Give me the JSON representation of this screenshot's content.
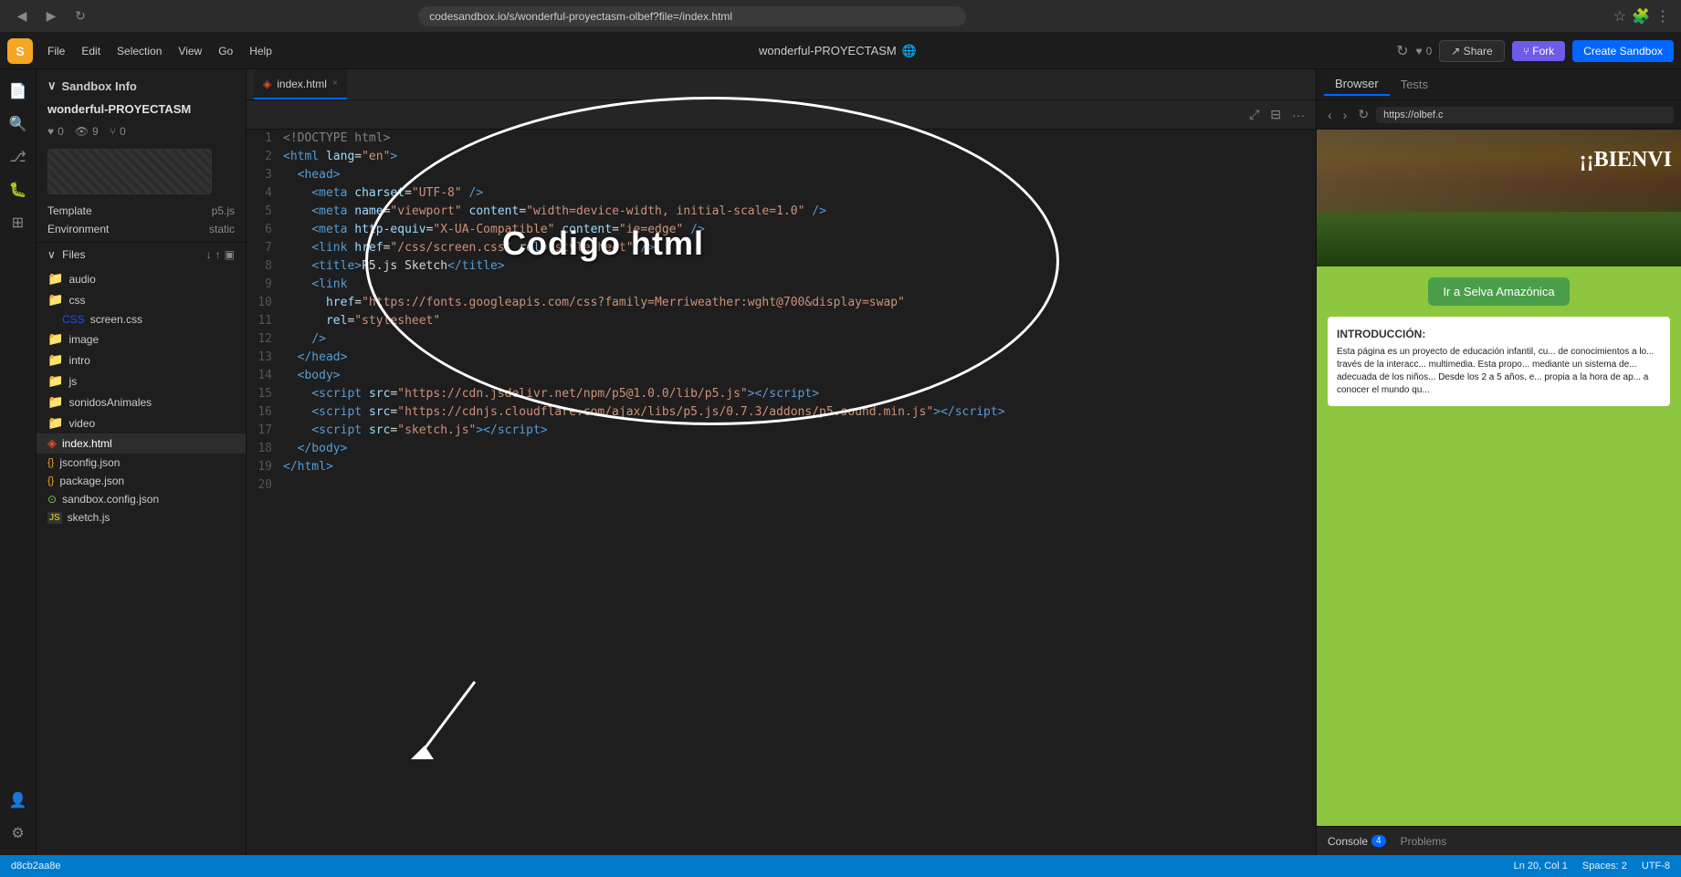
{
  "browser": {
    "url": "codesandbox.io/s/wonderful-proyectasm-olbef?file=/index.html",
    "back_icon": "◀",
    "forward_icon": "▶",
    "refresh_icon": "↻",
    "home_icon": "⌂"
  },
  "header": {
    "logo": "S",
    "menu": [
      "File",
      "Edit",
      "Selection",
      "View",
      "Go",
      "Help"
    ],
    "project_title": "wonderful-PROYECTASM",
    "globe_icon": "🌐",
    "heart_icon": "♥",
    "heart_count": "0",
    "eye_icon": "👁",
    "eye_count": "9",
    "fork_icon": "⑂",
    "fork_count": "0",
    "share_label": "↗ Share",
    "fork_label": "⑂ Fork",
    "create_sandbox_label": "Create Sandbox",
    "refresh_icon": "↻"
  },
  "sidebar": {
    "section_title": "Sandbox Info",
    "project_name": "wonderful-PROYECTASM",
    "stats": {
      "heart": "♥",
      "heart_count": "0",
      "eye": "👁",
      "eye_count": "9",
      "fork": "⑂",
      "fork_count": "0"
    },
    "labels": {
      "template": "Template",
      "environment": "Environment"
    },
    "template_value": "p5.js",
    "environment_value": "static",
    "files_section": "Files",
    "folders": [
      "audio",
      "css",
      "image",
      "intro",
      "js",
      "sonidosAnimales",
      "video"
    ],
    "files": [
      {
        "name": "screen.css",
        "type": "css"
      },
      {
        "name": "index.html",
        "type": "html",
        "active": true
      },
      {
        "name": "jsconfig.json",
        "type": "json"
      },
      {
        "name": "package.json",
        "type": "json"
      },
      {
        "name": "sandbox.config.json",
        "type": "special"
      },
      {
        "name": "sketch.js",
        "type": "js"
      }
    ]
  },
  "editor": {
    "tab_name": "index.html",
    "tab_icon": "◈",
    "lines": [
      {
        "num": 1,
        "content": "<!DOCTYPE html>"
      },
      {
        "num": 2,
        "content": "<html lang=\"en\">"
      },
      {
        "num": 3,
        "content": "  <head>"
      },
      {
        "num": 4,
        "content": "    <meta charset=\"UTF-8\" />"
      },
      {
        "num": 5,
        "content": "    <meta name=\"viewport\" content=\"width=device-width, initial-scale=1.0\" />"
      },
      {
        "num": 6,
        "content": "    <meta http-equiv=\"X-UA-Compatible\" content=\"ie=edge\" />"
      },
      {
        "num": 7,
        "content": "    <link href=\"/css/screen.css\" rel=\"stylesheet\" />"
      },
      {
        "num": 8,
        "content": "    <title>P5.js Sketch</title>"
      },
      {
        "num": 9,
        "content": "    <link"
      },
      {
        "num": 10,
        "content": "      href=\"https://fonts.googleapis.com/css?family=Merriweather:wght@700&display=swap\""
      },
      {
        "num": 11,
        "content": "      rel=\"stylesheet\""
      },
      {
        "num": 12,
        "content": "    />"
      },
      {
        "num": 13,
        "content": "  </head>"
      },
      {
        "num": 14,
        "content": "  <body>"
      },
      {
        "num": 15,
        "content": "    <script src=\"https://cdn.jsdelivr.net/npm/p5@1.0.0/lib/p5.js\"></script>"
      },
      {
        "num": 16,
        "content": "    <script src=\"https://cdnjs.cloudflare.com/ajax/libs/p5.js/0.7.3/addons/p5.sound.min.js\"></script>"
      },
      {
        "num": 17,
        "content": "    <script src=\"sketch.js\"></script>"
      },
      {
        "num": 18,
        "content": "  </body>"
      },
      {
        "num": 19,
        "content": "</html>"
      },
      {
        "num": 20,
        "content": ""
      }
    ],
    "annotation": {
      "text": "Codigo html",
      "arrow_text": "↙"
    }
  },
  "right_panel": {
    "tabs": [
      "Browser",
      "Tests"
    ],
    "active_tab": "Browser",
    "url": "https://olbef.c",
    "preview_title": "¡¡BIENVI",
    "amazon_btn": "Ir a Selva Amazónica",
    "intro_title": "Introducción:",
    "intro_text": "Esta página es un proyecto de educación infantil, cu... de conocimientos a lo... través de la interacc... multimedia. Esta propo... mediante un sistema de... adecuada de los niños... Desde los 2 a 5 años, e... propia a la hora de ap... a conocer el mundo qu..."
  },
  "bottom": {
    "position": "Ln 20, Col 1",
    "spaces": "Spaces: 2",
    "encoding": "UTF-8",
    "hash": "d8cb2aa8e",
    "console_label": "Console",
    "console_badge": "4",
    "problems_label": "Problems"
  },
  "icons": {
    "chevron_right": "›",
    "chevron_down": "⌄",
    "folder": "📁",
    "file_html": "◈",
    "file_json": "{}",
    "file_js": "JS",
    "file_css": "CSS",
    "close": "×",
    "expand": "⤢",
    "split": "⊟",
    "more": "···",
    "back": "‹",
    "forward": "›",
    "refresh": "↻",
    "layout": "▤",
    "search": "🔍",
    "settings": "⚙",
    "user": "👤",
    "bell": "🔔",
    "heart": "♥",
    "eye": "👁",
    "fork": "⑂",
    "add_file": "+",
    "add_folder": "📂",
    "upload": "↑",
    "collapse": "↓"
  }
}
